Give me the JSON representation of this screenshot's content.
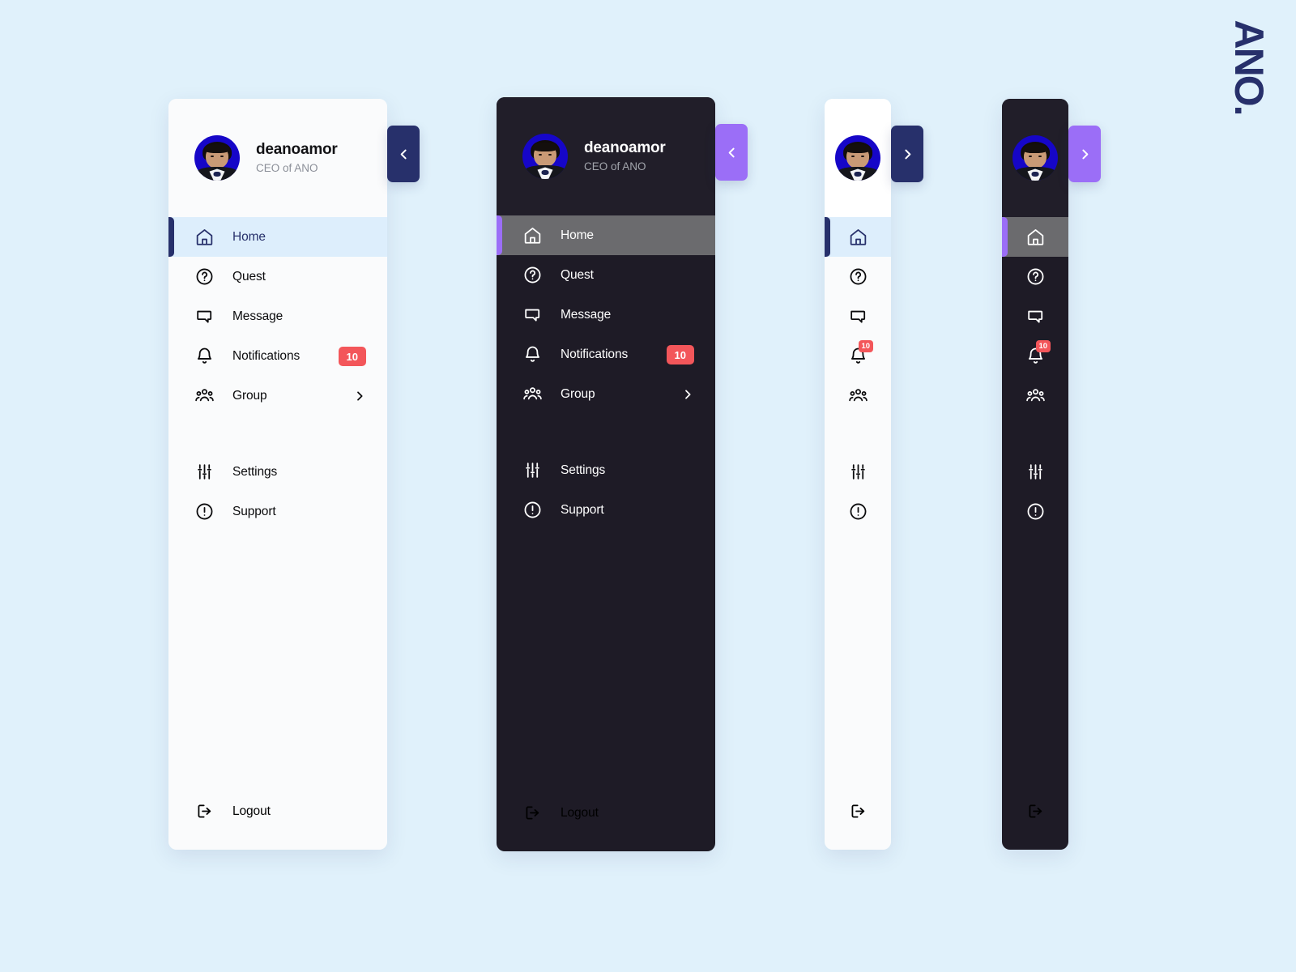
{
  "brand": {
    "logo_text": "ANO."
  },
  "profile": {
    "name": "deanoamor",
    "role": "CEO of ANO",
    "avatar_name": "user-avatar"
  },
  "nav": {
    "primary": [
      {
        "id": "home",
        "label": "Home",
        "icon": "home-icon",
        "active": true,
        "badge": null,
        "chevron": false
      },
      {
        "id": "quest",
        "label": "Quest",
        "icon": "question-circle-icon",
        "active": false,
        "badge": null,
        "chevron": false
      },
      {
        "id": "message",
        "label": "Message",
        "icon": "message-icon",
        "active": false,
        "badge": null,
        "chevron": false
      },
      {
        "id": "notifications",
        "label": "Notifications",
        "icon": "bell-icon",
        "active": false,
        "badge": "10",
        "chevron": false
      },
      {
        "id": "group",
        "label": "Group",
        "icon": "group-icon",
        "active": false,
        "badge": null,
        "chevron": true
      }
    ],
    "secondary": [
      {
        "id": "settings",
        "label": "Settings",
        "icon": "sliders-icon",
        "active": false,
        "badge": null,
        "chevron": false
      },
      {
        "id": "support",
        "label": "Support",
        "icon": "exclamation-circle-icon",
        "active": false,
        "badge": null,
        "chevron": false
      }
    ],
    "logout": {
      "id": "logout",
      "label": "Logout",
      "icon": "logout-icon"
    }
  },
  "toggles": {
    "collapse_label": "Collapse sidebar",
    "expand_label": "Expand sidebar",
    "collapse_icon": "chevron-left-icon",
    "expand_icon": "chevron-right-icon"
  },
  "variants": [
    {
      "id": "light-expanded",
      "theme": "light",
      "state": "expanded",
      "toggle_color": "#27306b",
      "toggle_direction": "left"
    },
    {
      "id": "dark-expanded",
      "theme": "dark",
      "state": "expanded",
      "toggle_color": "#9b6ef7",
      "toggle_direction": "left"
    },
    {
      "id": "light-rail",
      "theme": "light",
      "state": "collapsed",
      "toggle_color": "#27306b",
      "toggle_direction": "right"
    },
    {
      "id": "dark-rail",
      "theme": "dark",
      "state": "collapsed",
      "toggle_color": "#9b6ef7",
      "toggle_direction": "right"
    }
  ],
  "colors": {
    "page_background": "#e0f1fb",
    "light_panel": "#fafbfc",
    "dark_panel": "#1e1b26",
    "accent_navy": "#27306b",
    "accent_purple": "#9b6ef7",
    "active_light_row": "#ddeefc",
    "active_dark_row": "#6b6b6e",
    "badge_red": "#f3565a",
    "avatar_backdrop": "#1606c8"
  }
}
